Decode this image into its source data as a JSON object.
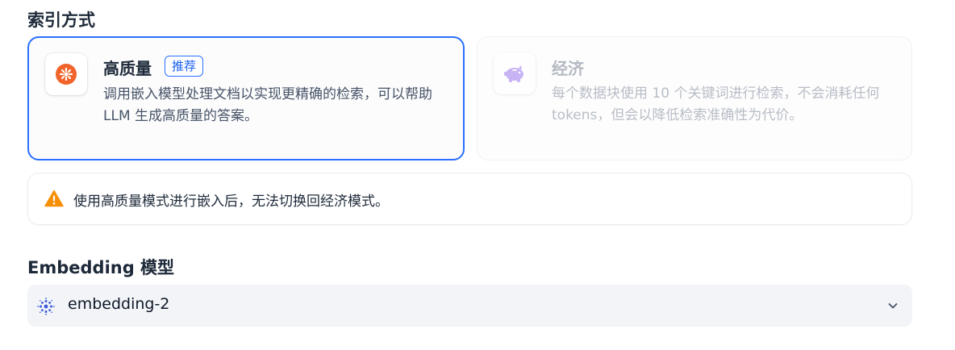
{
  "index_section": {
    "title": "索引方式",
    "options": [
      {
        "title": "高质量",
        "badge": "推荐",
        "description": "调用嵌入模型处理文档以实现更精确的检索，可以帮助 LLM 生成高质量的答案。",
        "icon": "sparkle-icon",
        "selected": true
      },
      {
        "title": "经济",
        "description": "每个数据块使用 10 个关键词进行检索，不会消耗任何 tokens，但会以降低检索准确性为代价。",
        "icon": "piggy-bank-icon",
        "selected": false
      }
    ],
    "warning": {
      "icon": "warning-icon",
      "text": "使用高质量模式进行嵌入后，无法切换回经济模式。"
    }
  },
  "embedding_section": {
    "title": "Embedding 模型",
    "selected_model": "embedding-2",
    "model_icon": "zhipu-model-icon",
    "dropdown_icon": "chevron-down-icon"
  },
  "colors": {
    "accent": "#2970ff",
    "high_quality_icon": "#f0642a",
    "economy_icon": "#9e77ed",
    "warning": "#f79009"
  }
}
